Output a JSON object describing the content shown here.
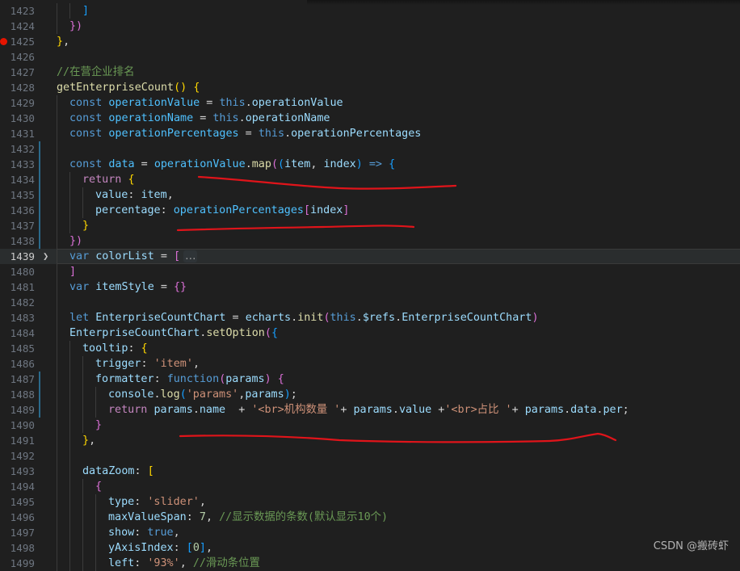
{
  "editor": {
    "lines": [
      {
        "n": "1423",
        "indent": 2,
        "t": [
          [
            "]",
            "br3"
          ]
        ]
      },
      {
        "n": "1424",
        "indent": 1,
        "t": [
          [
            "})",
            "br2"
          ]
        ]
      },
      {
        "n": "1425",
        "indent": 0,
        "bp": true,
        "t": [
          [
            "}",
            "br1"
          ],
          [
            ",",
            "op"
          ]
        ]
      },
      {
        "n": "1426",
        "indent": 0,
        "t": []
      },
      {
        "n": "1427",
        "indent": 0,
        "t": [
          [
            "//在营企业排名",
            "cmt"
          ]
        ]
      },
      {
        "n": "1428",
        "indent": 0,
        "t": [
          [
            "getEnterpriseCount",
            "fn"
          ],
          [
            "()",
            "br1"
          ],
          [
            " ",
            "op"
          ],
          [
            "{",
            "br1"
          ]
        ]
      },
      {
        "n": "1429",
        "indent": 1,
        "t": [
          [
            "const ",
            "kw"
          ],
          [
            "operationValue",
            "cst"
          ],
          [
            " = ",
            "op"
          ],
          [
            "this",
            "kw"
          ],
          [
            ".",
            "op"
          ],
          [
            "operationValue",
            "var"
          ]
        ]
      },
      {
        "n": "1430",
        "indent": 1,
        "t": [
          [
            "const ",
            "kw"
          ],
          [
            "operationName",
            "cst"
          ],
          [
            " = ",
            "op"
          ],
          [
            "this",
            "kw"
          ],
          [
            ".",
            "op"
          ],
          [
            "operationName",
            "var"
          ]
        ]
      },
      {
        "n": "1431",
        "indent": 1,
        "t": [
          [
            "const ",
            "kw"
          ],
          [
            "operationPercentages",
            "cst"
          ],
          [
            " = ",
            "op"
          ],
          [
            "this",
            "kw"
          ],
          [
            ".",
            "op"
          ],
          [
            "operationPercentages",
            "var"
          ]
        ]
      },
      {
        "n": "1432",
        "indent": 1,
        "mod": true,
        "t": []
      },
      {
        "n": "1433",
        "indent": 1,
        "mod": true,
        "t": [
          [
            "const ",
            "kw"
          ],
          [
            "data",
            "cst"
          ],
          [
            " = ",
            "op"
          ],
          [
            "operationValue",
            "cst"
          ],
          [
            ".",
            "op"
          ],
          [
            "map",
            "fn"
          ],
          [
            "(",
            "br2"
          ],
          [
            "(",
            "br3"
          ],
          [
            "item",
            "var"
          ],
          [
            ", ",
            "op"
          ],
          [
            "index",
            "var"
          ],
          [
            ")",
            "br3"
          ],
          [
            " ",
            "op"
          ],
          [
            "=>",
            "kw"
          ],
          [
            " ",
            "op"
          ],
          [
            "{",
            "br3"
          ]
        ]
      },
      {
        "n": "1434",
        "indent": 2,
        "mod": true,
        "t": [
          [
            "return ",
            "kw2"
          ],
          [
            "{",
            "br1"
          ]
        ]
      },
      {
        "n": "1435",
        "indent": 3,
        "mod": true,
        "t": [
          [
            "value",
            "var"
          ],
          [
            ": ",
            "op"
          ],
          [
            "item",
            "var"
          ],
          [
            ",",
            "op"
          ]
        ]
      },
      {
        "n": "1436",
        "indent": 3,
        "mod": true,
        "t": [
          [
            "percentage",
            "var"
          ],
          [
            ": ",
            "op"
          ],
          [
            "operationPercentages",
            "cst"
          ],
          [
            "[",
            "br2"
          ],
          [
            "index",
            "var"
          ],
          [
            "]",
            "br2"
          ]
        ]
      },
      {
        "n": "1437",
        "indent": 2,
        "mod": true,
        "t": [
          [
            "}",
            "br1"
          ]
        ]
      },
      {
        "n": "1438",
        "indent": 1,
        "mod": true,
        "t": [
          [
            "})",
            "br2"
          ]
        ]
      },
      {
        "n": "1439",
        "indent": 1,
        "cur": true,
        "fold": true,
        "t": [
          [
            "var ",
            "kw"
          ],
          [
            "colorList",
            "var"
          ],
          [
            " = ",
            "op"
          ],
          [
            "[",
            "br2"
          ],
          [
            "…",
            "ellipsis"
          ]
        ]
      },
      {
        "n": "1480",
        "indent": 1,
        "t": [
          [
            "]",
            "br2"
          ]
        ]
      },
      {
        "n": "1481",
        "indent": 1,
        "t": [
          [
            "var ",
            "kw"
          ],
          [
            "itemStyle",
            "var"
          ],
          [
            " = ",
            "op"
          ],
          [
            "{}",
            "br2"
          ]
        ]
      },
      {
        "n": "1482",
        "indent": 1,
        "t": []
      },
      {
        "n": "1483",
        "indent": 1,
        "t": [
          [
            "let ",
            "kw"
          ],
          [
            "EnterpriseCountChart",
            "var"
          ],
          [
            " = ",
            "op"
          ],
          [
            "echarts",
            "var"
          ],
          [
            ".",
            "op"
          ],
          [
            "init",
            "fn"
          ],
          [
            "(",
            "br2"
          ],
          [
            "this",
            "kw"
          ],
          [
            ".",
            "op"
          ],
          [
            "$refs",
            "var"
          ],
          [
            ".",
            "op"
          ],
          [
            "EnterpriseCountChart",
            "var"
          ],
          [
            ")",
            "br2"
          ]
        ]
      },
      {
        "n": "1484",
        "indent": 1,
        "t": [
          [
            "EnterpriseCountChart",
            "var"
          ],
          [
            ".",
            "op"
          ],
          [
            "setOption",
            "fn"
          ],
          [
            "(",
            "br2"
          ],
          [
            "{",
            "br3"
          ]
        ]
      },
      {
        "n": "1485",
        "indent": 2,
        "t": [
          [
            "tooltip",
            "var"
          ],
          [
            ": ",
            "op"
          ],
          [
            "{",
            "br1"
          ]
        ]
      },
      {
        "n": "1486",
        "indent": 3,
        "t": [
          [
            "trigger",
            "var"
          ],
          [
            ": ",
            "op"
          ],
          [
            "'item'",
            "str"
          ],
          [
            ",",
            "op"
          ]
        ]
      },
      {
        "n": "1487",
        "indent": 3,
        "mod": true,
        "t": [
          [
            "formatter",
            "var"
          ],
          [
            ": ",
            "op"
          ],
          [
            "function",
            "kw"
          ],
          [
            "(",
            "br2"
          ],
          [
            "params",
            "var"
          ],
          [
            ")",
            "br2"
          ],
          [
            " ",
            "op"
          ],
          [
            "{",
            "br2"
          ]
        ]
      },
      {
        "n": "1488",
        "indent": 4,
        "mod": true,
        "t": [
          [
            "console",
            "var"
          ],
          [
            ".",
            "op"
          ],
          [
            "log",
            "fn"
          ],
          [
            "(",
            "br3"
          ],
          [
            "'params'",
            "str"
          ],
          [
            ",",
            "op"
          ],
          [
            "params",
            "var"
          ],
          [
            ")",
            "br3"
          ],
          [
            ";",
            "op"
          ]
        ]
      },
      {
        "n": "1489",
        "indent": 4,
        "mod": true,
        "t": [
          [
            "return ",
            "kw2"
          ],
          [
            "params",
            "var"
          ],
          [
            ".",
            "op"
          ],
          [
            "name",
            "var"
          ],
          [
            "  + ",
            "op"
          ],
          [
            "'<br>机构数量 '",
            "str"
          ],
          [
            "+ ",
            "op"
          ],
          [
            "params",
            "var"
          ],
          [
            ".",
            "op"
          ],
          [
            "value",
            "var"
          ],
          [
            " +",
            "op"
          ],
          [
            "'<br>占比 '",
            "str"
          ],
          [
            "+ ",
            "op"
          ],
          [
            "params",
            "var"
          ],
          [
            ".",
            "op"
          ],
          [
            "data",
            "var"
          ],
          [
            ".",
            "op"
          ],
          [
            "per",
            "var"
          ],
          [
            ";",
            "op"
          ]
        ]
      },
      {
        "n": "1490",
        "indent": 3,
        "t": [
          [
            "}",
            "br2"
          ]
        ]
      },
      {
        "n": "1491",
        "indent": 2,
        "t": [
          [
            "}",
            "br1"
          ],
          [
            ",",
            "op"
          ]
        ]
      },
      {
        "n": "1492",
        "indent": 2,
        "t": []
      },
      {
        "n": "1493",
        "indent": 2,
        "t": [
          [
            "dataZoom",
            "var"
          ],
          [
            ": ",
            "op"
          ],
          [
            "[",
            "br1"
          ]
        ]
      },
      {
        "n": "1494",
        "indent": 3,
        "t": [
          [
            "{",
            "br2"
          ]
        ]
      },
      {
        "n": "1495",
        "indent": 4,
        "t": [
          [
            "type",
            "var"
          ],
          [
            ": ",
            "op"
          ],
          [
            "'slider'",
            "str"
          ],
          [
            ",",
            "op"
          ]
        ]
      },
      {
        "n": "1496",
        "indent": 4,
        "t": [
          [
            "maxValueSpan",
            "var"
          ],
          [
            ": ",
            "op"
          ],
          [
            "7",
            "num"
          ],
          [
            ", ",
            "op"
          ],
          [
            "//显示数据的条数(默认显示10个)",
            "cmt"
          ]
        ]
      },
      {
        "n": "1497",
        "indent": 4,
        "t": [
          [
            "show",
            "var"
          ],
          [
            ": ",
            "op"
          ],
          [
            "true",
            "kw"
          ],
          [
            ",",
            "op"
          ]
        ]
      },
      {
        "n": "1498",
        "indent": 4,
        "t": [
          [
            "yAxisIndex",
            "var"
          ],
          [
            ": ",
            "op"
          ],
          [
            "[",
            "br3"
          ],
          [
            "0",
            "num"
          ],
          [
            "]",
            "br3"
          ],
          [
            ",",
            "op"
          ]
        ]
      },
      {
        "n": "1499",
        "indent": 4,
        "t": [
          [
            "left",
            "var"
          ],
          [
            ": ",
            "op"
          ],
          [
            "'93%'",
            "str"
          ],
          [
            ", ",
            "op"
          ],
          [
            "//滑动条位置",
            "cmt"
          ]
        ]
      }
    ]
  },
  "watermark": "CSDN @搬砖虾",
  "colors": {
    "background": "#1f1f1f",
    "annotation": "#e0141a",
    "breakpoint": "#e51400"
  }
}
